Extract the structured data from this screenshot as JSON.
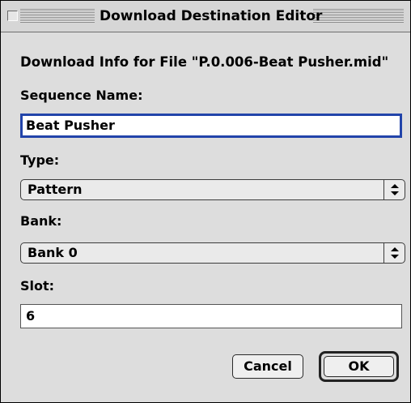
{
  "window": {
    "title": "Download Destination Editor"
  },
  "dialog": {
    "info": "Download Info for File \"P.0.006-Beat Pusher.mid\"",
    "sequence": {
      "label": "Sequence Name:",
      "value": "Beat Pusher"
    },
    "type": {
      "label": "Type:",
      "value": "Pattern"
    },
    "bank": {
      "label": "Bank:",
      "value": "Bank 0"
    },
    "slot": {
      "label": "Slot:",
      "value": "6"
    },
    "buttons": {
      "cancel": "Cancel",
      "ok": "OK"
    }
  },
  "icons": {
    "popup_arrows": "up-down-arrows-icon",
    "close_box": "close-box-icon"
  },
  "colors": {
    "focus_ring": "#2244aa",
    "window_bg": "#dddddd"
  }
}
